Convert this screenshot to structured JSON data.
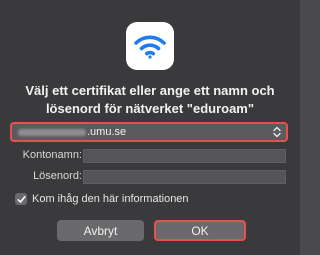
{
  "dialog": {
    "icon": "wifi-icon",
    "title_line1": "Välj ett certifikat eller ange ett namn och",
    "title_line2": "lösenord för nätverket \"eduroam\""
  },
  "certificate_select": {
    "selected_value_suffix": ".umu.se",
    "icon": "up-down-chevron-icon"
  },
  "fields": {
    "account_label": "Kontonamn:",
    "account_value": "",
    "password_label": "Lösenord:",
    "password_value": ""
  },
  "remember": {
    "label": "Kom ihåg den här informationen",
    "checked": true
  },
  "buttons": {
    "cancel_label": "Avbryt",
    "ok_label": "OK"
  },
  "colors": {
    "wifi_blue": "#1f7cf0",
    "highlight_red": "#e8504f",
    "dialog_bg": "#3a3a3c"
  }
}
